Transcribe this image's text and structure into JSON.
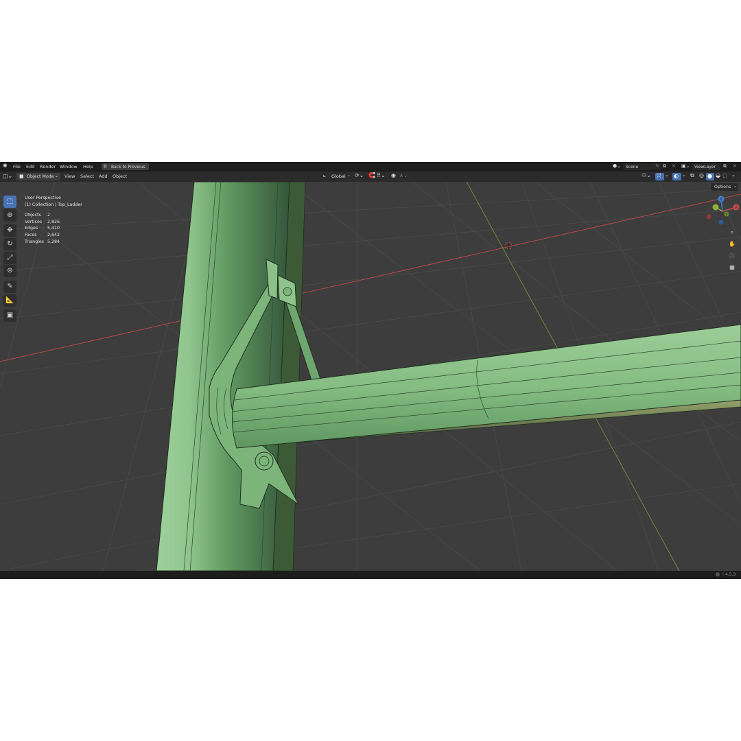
{
  "menu": {
    "file": "File",
    "edit": "Edit",
    "render": "Render",
    "window": "Window",
    "help": "Help",
    "back_to_previous": "Back to Previous"
  },
  "workspace": {
    "scene_label": "Scene",
    "view_layer_label": "ViewLayer"
  },
  "viewport_header": {
    "mode": "Object Mode",
    "view": "View",
    "select": "Select",
    "add": "Add",
    "object": "Object",
    "transform_orientation": "Global",
    "options": "Options"
  },
  "overlay": {
    "perspective": "User Perspective",
    "collection": "(1) Collection | Top_Ladder",
    "stats": [
      {
        "label": "Objects",
        "value": "2"
      },
      {
        "label": "Vertices",
        "value": "2,826"
      },
      {
        "label": "Edges",
        "value": "5,410"
      },
      {
        "label": "Faces",
        "value": "2,642"
      },
      {
        "label": "Triangles",
        "value": "5,284"
      }
    ]
  },
  "gizmo": {
    "x": "X",
    "y": "Y",
    "z": "Z"
  },
  "status": {
    "version": "4.5.3"
  },
  "colors": {
    "mesh_light": "#8cc08a",
    "mesh_mid": "#6fa66f",
    "mesh_dark": "#3f6a3f",
    "accent": "#4772b3",
    "x_axis": "#c84b4b",
    "y_axis": "#8bb33b",
    "z_axis": "#3d7fd6"
  },
  "icons": {
    "blender_logo": "blender-logo-icon",
    "select_box": "select-box-icon",
    "cursor": "cursor-icon",
    "move": "move-icon",
    "rotate": "rotate-icon",
    "scale": "scale-icon",
    "transform": "transform-icon",
    "annotate": "annotate-icon",
    "measure": "measure-icon",
    "add_cube": "add-cube-icon",
    "zoom": "zoom-icon",
    "pan": "hand-icon",
    "camera": "camera-icon",
    "ortho": "grid-icon"
  }
}
